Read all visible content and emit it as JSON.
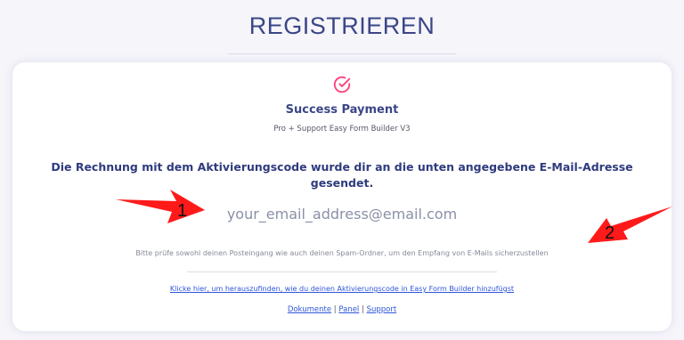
{
  "page": {
    "title": "REGISTRIEREN"
  },
  "card": {
    "icon": "check-circle-icon",
    "heading": "Success Payment",
    "subheading": "Pro + Support Easy Form Builder V3",
    "message": "Die Rechnung mit dem Aktivierungscode wurde dir an die unten angegebene E-Mail-Adresse gesendet.",
    "email": "your_email_address@email.com",
    "hint": "Bitte prüfe sowohl deinen Posteingang wie auch deinen Spam-Ordner, um den Empfang von E-Mails sicherzustellen",
    "help_link": "Klicke hier, um herauszufinden, wie du deinen Aktivierungscode in Easy Form Builder hinzufügst",
    "footer": {
      "link1": "Dokumente",
      "sep": "|",
      "link2": "Panel",
      "link3": "Support"
    }
  },
  "annotations": {
    "marker1": "1",
    "marker2": "2",
    "arrow_color": "#ff1a1a"
  },
  "colors": {
    "accent": "#3b4687",
    "icon": "#ff3e7a",
    "link": "#2f56d9"
  }
}
